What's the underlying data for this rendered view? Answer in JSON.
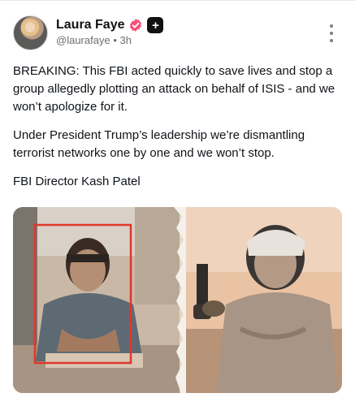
{
  "post": {
    "author_name": "Laura Faye",
    "author_handle": "@laurafaye",
    "separator": "•",
    "time_ago": "3h",
    "paragraphs": [
      "BREAKING: This FBI acted quickly to save lives and stop a group allegedly plotting an attack on behalf of ISIS - and we won’t apologize for it.",
      "Under President Trump’s leadership we’re dismantling terrorist networks one by one and we won’t stop.",
      "FBI Director Kash Patel"
    ],
    "plus_badge": "+"
  },
  "icons": {
    "verified": "verified-badge-icon",
    "plus": "plus-badge-icon",
    "more": "more-vertical-icon"
  },
  "colors": {
    "verified_badge": "#f2547d",
    "text": "#0f1419",
    "muted": "#6b7075",
    "highlight_box": "#e0362c"
  }
}
